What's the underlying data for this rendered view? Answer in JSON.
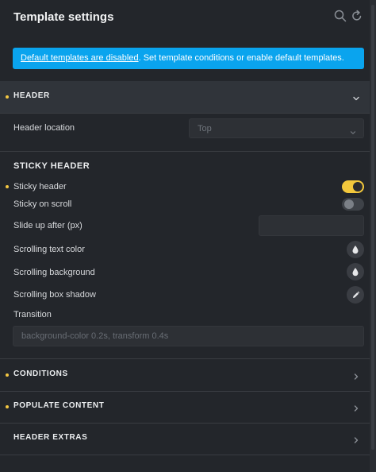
{
  "panel": {
    "title": "Template settings",
    "icons": {
      "search": "search-icon",
      "reset": "reset-icon"
    }
  },
  "banner": {
    "link_text": "Default templates are disabled",
    "rest_text": ". Set template conditions or enable default templates.",
    "color": "#0aa4ee"
  },
  "header_section": {
    "label": "HEADER",
    "expanded": true,
    "header_location": {
      "label": "Header location",
      "value": "Top"
    }
  },
  "sticky_header": {
    "title": "STICKY HEADER",
    "sticky_header": {
      "label": "Sticky header",
      "enabled": true
    },
    "sticky_on_scroll": {
      "label": "Sticky on scroll",
      "enabled": false
    },
    "slide_up_after": {
      "label": "Slide up after (px)",
      "value": ""
    },
    "scrolling_text_color": {
      "label": "Scrolling text color",
      "icon": "color-drop-icon"
    },
    "scrolling_background": {
      "label": "Scrolling background",
      "icon": "color-drop-icon"
    },
    "scrolling_box_shadow": {
      "label": "Scrolling box shadow",
      "icon": "pencil-icon"
    },
    "transition": {
      "label": "Transition",
      "placeholder": "background-color 0.2s, transform 0.4s"
    }
  },
  "sections": [
    {
      "label": "CONDITIONS",
      "has_indicator": true
    },
    {
      "label": "POPULATE CONTENT",
      "has_indicator": true
    },
    {
      "label": "HEADER EXTRAS",
      "has_indicator": false
    }
  ],
  "colors": {
    "accent": "#f3c83c",
    "background": "#23262b",
    "header_bg": "#30343a"
  }
}
